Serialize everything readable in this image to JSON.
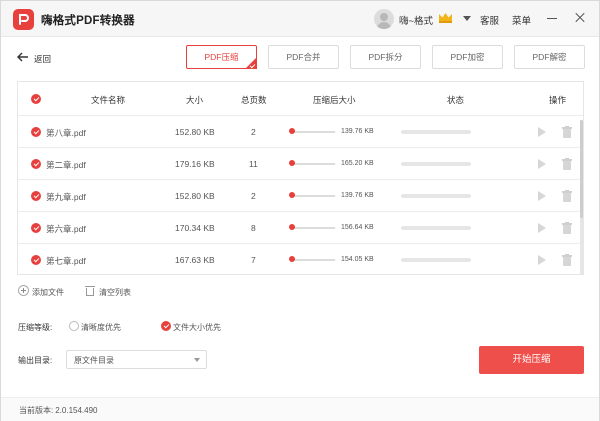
{
  "app": {
    "title": "嗨格式PDF转换器"
  },
  "header": {
    "username": "嗨~格式",
    "service": "客服",
    "menu": "菜单"
  },
  "nav": {
    "back_label": "返回"
  },
  "tabs": [
    {
      "label": "PDF压缩",
      "active": true
    },
    {
      "label": "PDF合并",
      "active": false
    },
    {
      "label": "PDF拆分",
      "active": false
    },
    {
      "label": "PDF加密",
      "active": false
    },
    {
      "label": "PDF解密",
      "active": false
    }
  ],
  "table": {
    "columns": {
      "name": "文件名称",
      "size": "大小",
      "pages": "总页数",
      "compressed": "压缩后大小",
      "status": "状态",
      "ops": "操作"
    },
    "rows": [
      {
        "name": "第八章.pdf",
        "size": "152.80 KB",
        "pages": "2",
        "compressed": "139.76 KB"
      },
      {
        "name": "第二章.pdf",
        "size": "179.16 KB",
        "pages": "11",
        "compressed": "165.20 KB"
      },
      {
        "name": "第九章.pdf",
        "size": "152.80 KB",
        "pages": "2",
        "compressed": "139.76 KB"
      },
      {
        "name": "第六章.pdf",
        "size": "170.34 KB",
        "pages": "8",
        "compressed": "156.64 KB"
      },
      {
        "name": "第七章.pdf",
        "size": "167.63 KB",
        "pages": "7",
        "compressed": "154.05 KB"
      }
    ]
  },
  "actions": {
    "add_file": "添加文件",
    "clear_list": "清空列表"
  },
  "compression": {
    "label": "压缩等级:",
    "option_clarity": "清晰度优先",
    "option_size": "文件大小优先",
    "selected": "文件大小优先"
  },
  "output": {
    "label": "输出目录:",
    "value": "原文件目录"
  },
  "start_button": "开始压缩",
  "footer": {
    "version_label": "当前版本:",
    "version": "2.0.154.490"
  },
  "colors": {
    "accent": "#e8403d",
    "button": "#ef4f4a"
  }
}
